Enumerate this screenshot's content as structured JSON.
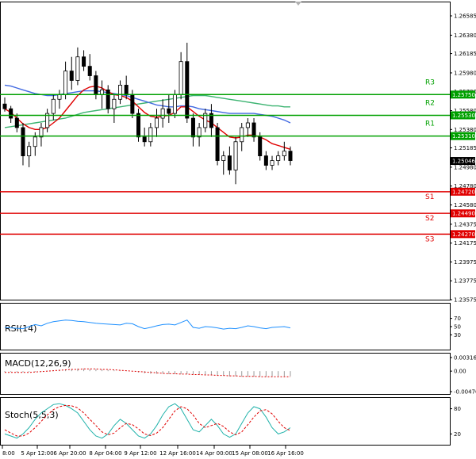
{
  "chart_data": {
    "type": "candlestick",
    "x_ticks": [
      "8:00",
      "5 Apr 12:00",
      "6 Apr 20:00",
      "8 Apr 04:00",
      "9 Apr 12:00",
      "12 Apr 16:00",
      "14 Apr 00:00",
      "15 Apr 08:00",
      "16 Apr 16:00"
    ],
    "price_axis": {
      "ticks": [
        "1.26585",
        "1.26380",
        "1.26185",
        "1.25980",
        "1.25780",
        "1.25580",
        "1.25380",
        "1.25185",
        "1.24980",
        "1.24780",
        "1.24580",
        "1.24375",
        "1.24175",
        "1.23975",
        "1.23775",
        "1.23575"
      ],
      "ylim": [
        1.23575,
        1.26585
      ]
    },
    "levels": [
      {
        "name": "R3",
        "value": "1.25750",
        "color": "#00a000"
      },
      {
        "name": "R2",
        "value": "1.25530",
        "color": "#00a000"
      },
      {
        "name": "R1",
        "value": "1.25310",
        "color": "#00a000"
      },
      {
        "name": "S1",
        "value": "1.24720",
        "color": "#e00000"
      },
      {
        "name": "S2",
        "value": "1.24490",
        "color": "#e00000"
      },
      {
        "name": "S3",
        "value": "1.24270",
        "color": "#e00000"
      }
    ],
    "current_price": "1.25046",
    "candles": [
      [
        1.2565,
        1.2572,
        1.2557,
        1.256
      ],
      [
        1.256,
        1.2563,
        1.2545,
        1.255
      ],
      [
        1.255,
        1.2555,
        1.2535,
        1.254
      ],
      [
        1.254,
        1.2545,
        1.25,
        1.251
      ],
      [
        1.251,
        1.2525,
        1.2498,
        1.252
      ],
      [
        1.252,
        1.2535,
        1.251,
        1.253
      ],
      [
        1.253,
        1.2545,
        1.252,
        1.254
      ],
      [
        1.254,
        1.256,
        1.2535,
        1.2555
      ],
      [
        1.2555,
        1.2575,
        1.2548,
        1.257
      ],
      [
        1.257,
        1.258,
        1.256,
        1.2575
      ],
      [
        1.2575,
        1.261,
        1.257,
        1.26
      ],
      [
        1.26,
        1.2615,
        1.258,
        1.259
      ],
      [
        1.259,
        1.2625,
        1.2585,
        1.2615
      ],
      [
        1.2615,
        1.2622,
        1.26,
        1.2605
      ],
      [
        1.2605,
        1.2618,
        1.259,
        1.2595
      ],
      [
        1.2595,
        1.26,
        1.257,
        1.2575
      ],
      [
        1.2575,
        1.259,
        1.256,
        1.258
      ],
      [
        1.258,
        1.2585,
        1.2555,
        1.256
      ],
      [
        1.256,
        1.2575,
        1.2545,
        1.257
      ],
      [
        1.257,
        1.259,
        1.2565,
        1.2585
      ],
      [
        1.2585,
        1.2595,
        1.257,
        1.2575
      ],
      [
        1.2575,
        1.258,
        1.255,
        1.2555
      ],
      [
        1.2555,
        1.256,
        1.2525,
        1.253
      ],
      [
        1.253,
        1.254,
        1.252,
        1.2525
      ],
      [
        1.2525,
        1.2545,
        1.252,
        1.254
      ],
      [
        1.254,
        1.256,
        1.253,
        1.255
      ],
      [
        1.255,
        1.257,
        1.254,
        1.256
      ],
      [
        1.256,
        1.2575,
        1.2545,
        1.2555
      ],
      [
        1.2555,
        1.258,
        1.255,
        1.2575
      ],
      [
        1.2575,
        1.262,
        1.257,
        1.261
      ],
      [
        1.261,
        1.263,
        1.2545,
        1.255
      ],
      [
        1.255,
        1.2555,
        1.252,
        1.253
      ],
      [
        1.253,
        1.2545,
        1.252,
        1.254
      ],
      [
        1.254,
        1.256,
        1.2535,
        1.2555
      ],
      [
        1.2555,
        1.2565,
        1.253,
        1.254
      ],
      [
        1.254,
        1.2545,
        1.25,
        1.2505
      ],
      [
        1.2505,
        1.2515,
        1.249,
        1.251
      ],
      [
        1.251,
        1.252,
        1.249,
        1.2495
      ],
      [
        1.2495,
        1.253,
        1.248,
        1.2525
      ],
      [
        1.2525,
        1.2545,
        1.2515,
        1.254
      ],
      [
        1.254,
        1.255,
        1.253,
        1.2545
      ],
      [
        1.2545,
        1.255,
        1.2525,
        1.253
      ],
      [
        1.253,
        1.2535,
        1.2505,
        1.251
      ],
      [
        1.251,
        1.2515,
        1.2495,
        1.25
      ],
      [
        1.25,
        1.251,
        1.2495,
        1.2505
      ],
      [
        1.2505,
        1.2515,
        1.25,
        1.251
      ],
      [
        1.251,
        1.2525,
        1.2505,
        1.2515
      ],
      [
        1.2515,
        1.252,
        1.25,
        1.2505
      ]
    ],
    "ma_red": [
      1.256,
      1.2556,
      1.255,
      1.2544,
      1.254,
      1.2538,
      1.2538,
      1.254,
      1.2545,
      1.255,
      1.2558,
      1.2566,
      1.2574,
      1.258,
      1.2583,
      1.2584,
      1.2582,
      1.2578,
      1.2575,
      1.2574,
      1.2572,
      1.2568,
      1.2562,
      1.2556,
      1.2552,
      1.2551,
      1.2552,
      1.2553,
      1.2556,
      1.2562,
      1.2562,
      1.2557,
      1.2552,
      1.2548,
      1.2545,
      1.254,
      1.2535,
      1.253,
      1.2529,
      1.253,
      1.2532,
      1.2532,
      1.253,
      1.2527,
      1.2523,
      1.2521,
      1.2519,
      1.2517
    ],
    "ma_blue": [
      1.2585,
      1.2584,
      1.2582,
      1.258,
      1.2578,
      1.2576,
      1.2575,
      1.2574,
      1.2574,
      1.2575,
      1.2576,
      1.2577,
      1.2578,
      1.2579,
      1.2579,
      1.2579,
      1.2578,
      1.2577,
      1.2576,
      1.2575,
      1.2574,
      1.2572,
      1.257,
      1.2568,
      1.2566,
      1.2564,
      1.2563,
      1.2562,
      1.2562,
      1.2563,
      1.2563,
      1.2562,
      1.256,
      1.2559,
      1.2558,
      1.2557,
      1.2556,
      1.2555,
      1.2555,
      1.2555,
      1.2555,
      1.2555,
      1.2554,
      1.2553,
      1.2552,
      1.255,
      1.2548,
      1.2545
    ],
    "ma_green": [
      1.254,
      1.2541,
      1.2542,
      1.2543,
      1.2544,
      1.2545,
      1.2546,
      1.2547,
      1.2548,
      1.2549,
      1.255,
      1.2552,
      1.2554,
      1.2556,
      1.2557,
      1.2558,
      1.2559,
      1.256,
      1.2561,
      1.2562,
      1.2563,
      1.2564,
      1.2565,
      1.2566,
      1.2567,
      1.2568,
      1.2569,
      1.257,
      1.2571,
      1.2572,
      1.2573,
      1.2574,
      1.2574,
      1.2574,
      1.2573,
      1.2572,
      1.2571,
      1.257,
      1.2569,
      1.2568,
      1.2567,
      1.2566,
      1.2565,
      1.2564,
      1.2563,
      1.2563,
      1.2562,
      1.2562
    ],
    "rsi": {
      "label": "RSI(14)",
      "ticks": [
        "70",
        "50",
        "30"
      ],
      "ylim": [
        0,
        100
      ],
      "values": [
        48,
        47,
        46,
        45,
        50,
        55,
        52,
        58,
        62,
        64,
        66,
        65,
        63,
        62,
        60,
        58,
        57,
        56,
        55,
        54,
        58,
        57,
        50,
        45,
        48,
        52,
        55,
        56,
        54,
        60,
        66,
        48,
        46,
        50,
        49,
        47,
        44,
        46,
        45,
        48,
        52,
        50,
        47,
        45,
        48,
        49,
        50,
        47
      ]
    },
    "macd": {
      "label": "MACD(12,26,9)",
      "ticks": [
        "0.00316",
        "0.00",
        "-0.004763"
      ],
      "ylim": [
        -0.004763,
        0.00316
      ],
      "hist": [
        -0.0002,
        -0.0002,
        -0.0003,
        -0.0003,
        -0.0002,
        -0.0002,
        -0.0001,
        0.0001,
        0.0002,
        0.0003,
        0.0004,
        0.0005,
        0.0006,
        0.0006,
        0.0005,
        0.0005,
        0.0004,
        0.0003,
        0.0002,
        0.0001,
        0.0001,
        -0.0001,
        -0.0003,
        -0.0005,
        -0.0006,
        -0.0006,
        -0.0006,
        -0.0007,
        -0.0007,
        -0.0007,
        -0.0007,
        -0.0008,
        -0.0009,
        -0.0009,
        -0.0009,
        -0.001,
        -0.0011,
        -0.0012,
        -0.0012,
        -0.0013,
        -0.0013,
        -0.0013,
        -0.0013,
        -0.0013,
        -0.0013,
        -0.0012,
        -0.0012,
        -0.0012
      ],
      "signal": [
        -0.0003,
        -0.0003,
        -0.0003,
        -0.0003,
        -0.0003,
        -0.0002,
        -0.0001,
        0.0,
        0.0001,
        0.0002,
        0.0003,
        0.0004,
        0.0004,
        0.0005,
        0.0005,
        0.0005,
        0.0004,
        0.0004,
        0.0003,
        0.0002,
        0.0001,
        0.0,
        -0.0001,
        -0.0002,
        -0.0003,
        -0.0004,
        -0.0005,
        -0.0006,
        -0.0006,
        -0.0007,
        -0.0007,
        -0.0008,
        -0.0008,
        -0.0009,
        -0.0009,
        -0.001,
        -0.001,
        -0.0011,
        -0.0011,
        -0.0012,
        -0.0012,
        -0.0012,
        -0.0013,
        -0.0013,
        -0.0013,
        -0.0013,
        -0.0013,
        -0.0013
      ]
    },
    "stoch": {
      "label": "Stoch(5,5,3)",
      "ticks": [
        "80",
        "20"
      ],
      "ylim": [
        0,
        100
      ],
      "k": [
        20,
        15,
        10,
        20,
        35,
        55,
        70,
        80,
        90,
        92,
        88,
        80,
        70,
        50,
        30,
        15,
        10,
        20,
        40,
        55,
        45,
        30,
        15,
        10,
        20,
        40,
        65,
        85,
        92,
        80,
        55,
        30,
        25,
        40,
        55,
        40,
        20,
        12,
        20,
        45,
        70,
        85,
        80,
        60,
        35,
        20,
        25,
        35
      ],
      "d": [
        30,
        22,
        15,
        15,
        22,
        35,
        50,
        65,
        78,
        85,
        88,
        87,
        82,
        70,
        55,
        40,
        25,
        18,
        22,
        35,
        45,
        42,
        32,
        20,
        16,
        22,
        35,
        55,
        75,
        85,
        80,
        65,
        45,
        35,
        40,
        45,
        38,
        25,
        18,
        25,
        42,
        60,
        75,
        78,
        68,
        50,
        35,
        28
      ]
    }
  }
}
